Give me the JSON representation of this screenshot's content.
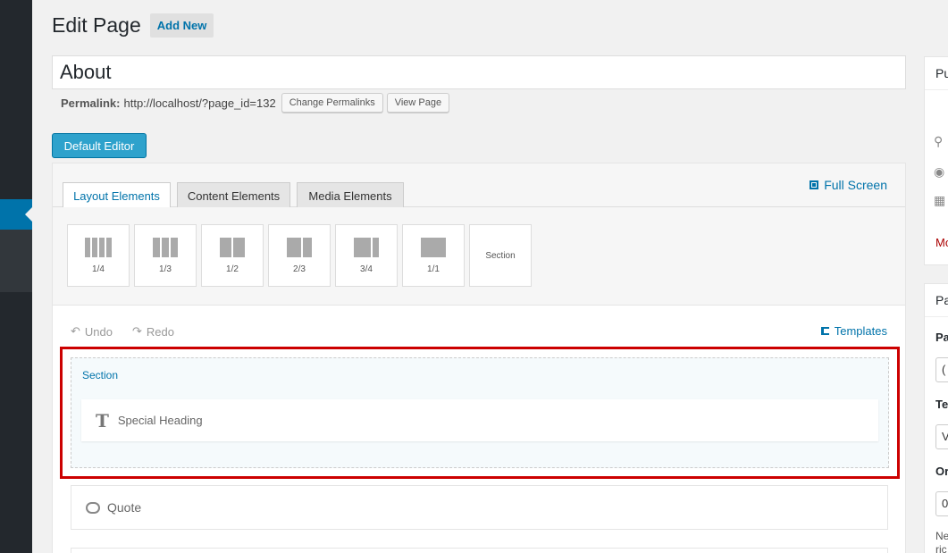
{
  "heading": {
    "title": "Edit Page",
    "add_new": "Add New"
  },
  "post": {
    "title": "About"
  },
  "permalink": {
    "label": "Permalink:",
    "url": "http://localhost/?page_id=132",
    "change_button": "Change Permalinks",
    "view_button": "View Page"
  },
  "editor": {
    "default_editor_button": "Default Editor"
  },
  "builder": {
    "tabs": [
      {
        "label": "Layout Elements",
        "active": true
      },
      {
        "label": "Content Elements",
        "active": false
      },
      {
        "label": "Media Elements",
        "active": false
      }
    ],
    "full_screen": "Full Screen",
    "layout_tiles": [
      {
        "label": "1/4"
      },
      {
        "label": "1/3"
      },
      {
        "label": "1/2"
      },
      {
        "label": "2/3"
      },
      {
        "label": "3/4"
      },
      {
        "label": "1/1"
      },
      {
        "label": "Section"
      }
    ],
    "undo": "Undo",
    "redo": "Redo",
    "templates": "Templates",
    "section": {
      "label": "Section",
      "element": "Special Heading"
    },
    "quote": "Quote"
  },
  "sidebar_right": {
    "publish_title": "Pu",
    "publish_trash": "Mo",
    "attr_title": "Pa",
    "attr_parent_label": "Pa",
    "attr_parent_value": "(",
    "attr_template_label": "Te",
    "attr_template_value": "V",
    "attr_order_label": "Or",
    "attr_order_value": "0",
    "attr_note_1": "Ne",
    "attr_note_2": "ric"
  },
  "colors": {
    "accent": "#0073aa",
    "primary_button": "#2ea2cc",
    "highlight": "#cc0000",
    "admin_bar": "#23282d"
  },
  "icons": {
    "undo": "undo-arrow-icon",
    "redo": "redo-arrow-icon",
    "full_screen": "expand-icon",
    "templates": "templates-icon",
    "heading": "text-t-icon",
    "quote": "speech-bubble-icon"
  }
}
